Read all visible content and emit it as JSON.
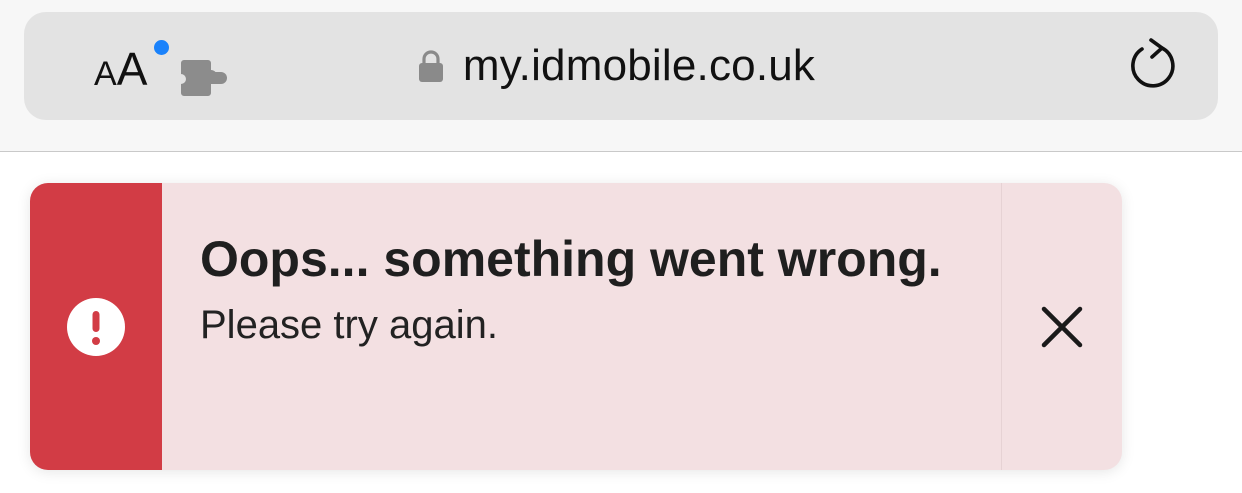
{
  "browser": {
    "text_size_label_small": "A",
    "text_size_label_large": "A",
    "url": "my.idmobile.co.uk",
    "icons": {
      "text_size": "text-size-icon",
      "extension": "puzzle-icon",
      "lock": "lock-icon",
      "reload": "reload-icon"
    },
    "colors": {
      "notify_dot": "#1a82fb"
    }
  },
  "alert": {
    "title": "Oops... something went wrong.",
    "message": "Please try again.",
    "icons": {
      "status": "exclamation-circle-icon",
      "close": "close-icon"
    },
    "colors": {
      "accent": "#d23c45",
      "background": "#f3e0e2"
    }
  }
}
